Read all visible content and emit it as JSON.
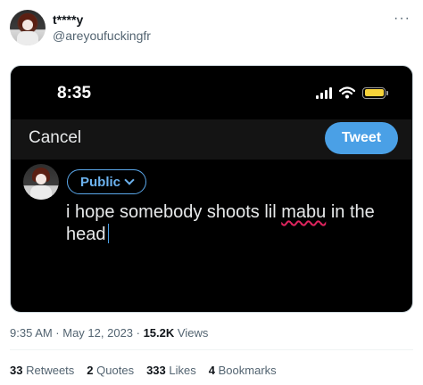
{
  "author": {
    "display_name": "t****y",
    "handle": "@areyoufuckingfr",
    "more_glyph": "···"
  },
  "screenshot": {
    "status_time": "8:35",
    "cancel_label": "Cancel",
    "tweet_label": "Tweet",
    "audience_label": "Public",
    "text_before": "i hope somebody shoots lil ",
    "text_misspelled": "mabu",
    "text_after": " in the head",
    "accent_color": "#4aa0e6",
    "battery_color": "#f7d33a"
  },
  "meta": {
    "timestamp": "9:35 AM · May 12, 2023 · ",
    "views_count": "15.2K",
    "views_label": " Views"
  },
  "stats": [
    {
      "count": "33",
      "label": "Retweets"
    },
    {
      "count": "2",
      "label": "Quotes"
    },
    {
      "count": "333",
      "label": "Likes"
    },
    {
      "count": "4",
      "label": "Bookmarks"
    }
  ]
}
